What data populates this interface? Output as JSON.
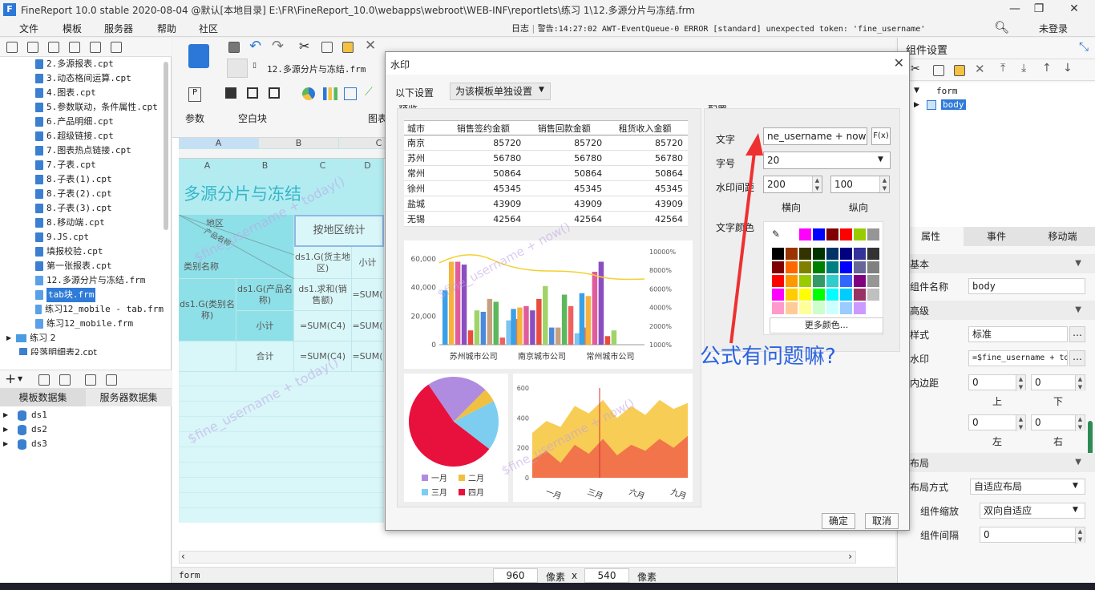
{
  "window": {
    "title": "FineReport 10.0 stable 2020-08-04 @默认[本地目录]    E:\\FR\\FineReport_10.0\\webapps\\webroot\\WEB-INF\\reportlets\\练习 1\\12.多源分片与冻结.frm",
    "minimize": "—",
    "maximize": "❐",
    "close": "✕"
  },
  "menubar": {
    "items": [
      "文件",
      "模板",
      "服务器",
      "帮助",
      "社区"
    ],
    "log_label": "日志",
    "warning_text": "警告:14:27:02 AWT-EventQueue-0 ERROR [standard] unexpected token: 'fine_username'",
    "login": "未登录"
  },
  "file_tree": {
    "items": [
      {
        "label": "2.多源报表.cpt",
        "type": "cpt"
      },
      {
        "label": "3.动态格间运算.cpt",
        "type": "cpt"
      },
      {
        "label": "4.图表.cpt",
        "type": "cpt"
      },
      {
        "label": "5.参数联动，条件属性.cpt",
        "type": "cpt"
      },
      {
        "label": "6.产品明细.cpt",
        "type": "cpt"
      },
      {
        "label": "6.超级链接.cpt",
        "type": "cpt"
      },
      {
        "label": "7.图表热点链接.cpt",
        "type": "cpt"
      },
      {
        "label": "7.子表.cpt",
        "type": "cpt"
      },
      {
        "label": "8.子表(1).cpt",
        "type": "cpt"
      },
      {
        "label": "8.子表(2).cpt",
        "type": "cpt"
      },
      {
        "label": "8.子表(3).cpt",
        "type": "cpt"
      },
      {
        "label": "8.移动端.cpt",
        "type": "cpt"
      },
      {
        "label": "9.JS.cpt",
        "type": "cpt"
      },
      {
        "label": "填报校验.cpt",
        "type": "cpt"
      },
      {
        "label": "第一张报表.cpt",
        "type": "cpt"
      },
      {
        "label": "12.多源分片与冻结.frm",
        "type": "frm"
      },
      {
        "label": "tab块.frm",
        "type": "frm",
        "selected": true
      },
      {
        "label": "练习12_mobile - tab.frm",
        "type": "frm"
      },
      {
        "label": "练习12_mobile.frm",
        "type": "frm"
      }
    ],
    "folder": "练习 2",
    "last_item": "段落明细表2.cpt"
  },
  "datasets": {
    "tabs": [
      "模板数据集",
      "服务器数据集"
    ],
    "items": [
      "ds1",
      "ds2",
      "ds3"
    ]
  },
  "ribbon": {
    "tab_name": "12.多源分片与冻结.frm",
    "group_param": "参数",
    "group_blank": "空白块",
    "group_chart": "图表"
  },
  "sheet": {
    "col_headers_top": [
      "A",
      "B",
      "C"
    ],
    "col_headers": [
      "A",
      "B",
      "C",
      "D"
    ],
    "report_title": "多源分片与冻结",
    "region_label": "地区",
    "product_label": "产品名称",
    "category_label": "类别名称",
    "region_stat": "按地区统计",
    "c3": "ds1.G(货主地区)",
    "d3": "小计",
    "a4": "ds1.G(类别名称)",
    "b4": "ds1.G(产品名称)",
    "c4": "ds1.求和(销售额)",
    "d4": "=SUM(",
    "b5": "小计",
    "c5": "=SUM(C4)",
    "d5": "=SUM(",
    "b6": "合计",
    "c6": "=SUM(C4)",
    "d6": "=SUM(",
    "watermark": "$fine_username + today()"
  },
  "statusbar": {
    "left": "form",
    "width": "960",
    "unit1": "像素",
    "x": "x",
    "height": "540",
    "unit2": "像素"
  },
  "right_panel": {
    "title": "组件设置",
    "tree_root": "form",
    "tree_child": "body",
    "tabs": [
      "属性",
      "事件",
      "移动端"
    ],
    "section_basic": "基本",
    "component_name_label": "组件名称",
    "component_name_value": "body",
    "section_advanced": "高级",
    "style_label": "样式",
    "style_value": "标准",
    "watermark_label": "水印",
    "watermark_value": "=$fine_username + today()",
    "padding_label": "内边距",
    "pad_top": "0",
    "pad_bottom": "0",
    "pad_left": "0",
    "pad_right": "0",
    "up": "上",
    "down": "下",
    "left": "左",
    "right": "右",
    "section_layout": "布局",
    "layout_mode_label": "布局方式",
    "layout_mode_value": "自适应布局",
    "scale_label": "组件缩放",
    "scale_value": "双向自适应",
    "gap_label": "组件间隔",
    "gap_value": "0"
  },
  "dialog": {
    "title": "水印",
    "setting_label": "以下设置",
    "setting_value": "为该模板单独设置",
    "preview_label": "预览",
    "config_label": "配置",
    "text_label": "文字",
    "text_value": "ne_username + now()",
    "fx": "F(x)",
    "size_label": "字号",
    "size_value": "20",
    "gap_label": "水印间距",
    "gap_h": "200",
    "gap_v": "100",
    "horizontal": "横向",
    "vertical": "纵向",
    "color_label": "文字颜色",
    "more_colors": "更多颜色...",
    "ok": "确定",
    "cancel": "取消",
    "table": {
      "headers": [
        "城市",
        "销售签约金额",
        "销售回款金额",
        "租货收入金额"
      ],
      "rows": [
        [
          "南京",
          "85720",
          "85720",
          "85720"
        ],
        [
          "苏州",
          "56780",
          "56780",
          "56780"
        ],
        [
          "常州",
          "50864",
          "50864",
          "50864"
        ],
        [
          "徐州",
          "45345",
          "45345",
          "45345"
        ],
        [
          "盐城",
          "43909",
          "43909",
          "43909"
        ],
        [
          "无锡",
          "42564",
          "42564",
          "42564"
        ]
      ]
    },
    "preview_watermark": "$fine_username + now()"
  },
  "chart_data": [
    {
      "type": "bar",
      "categories": [
        "苏州城市公司",
        "南京城市公司",
        "常州城市公司"
      ],
      "left_axis_ticks": [
        "0",
        "20,000",
        "40,000",
        "60,000"
      ],
      "right_axis_ticks": [
        "1000%",
        "2000%",
        "4000%",
        "6000%",
        "8000%",
        "10000%"
      ],
      "ylim": [
        0,
        65000
      ],
      "bars": [
        [
          38000,
          58000,
          58000,
          56000,
          10000,
          24000,
          23000,
          32000,
          30000,
          5000,
          17000,
          18000
        ],
        [
          25000,
          26000,
          27000,
          24000,
          32000,
          41000,
          12000,
          12000,
          35000,
          27000,
          8000,
          12000
        ],
        [
          36000,
          34000,
          51000,
          58000,
          6000,
          10000
        ]
      ],
      "bar_colors": [
        "#3aa0e8",
        "#f6b23c",
        "#e05c9c",
        "#8b4ec0",
        "#e74c3c",
        "#a0d468",
        "#4a89dc",
        "#c6a080",
        "#5cb85c",
        "#f06060",
        "#7dc4f0",
        "#d08060"
      ]
    },
    {
      "type": "pie",
      "legend": [
        "一月",
        "二月",
        "三月",
        "四月"
      ],
      "values": [
        22,
        5,
        18,
        55
      ],
      "colors": [
        "#b08ce0",
        "#f0c040",
        "#7ccdf0",
        "#e8103c"
      ]
    },
    {
      "type": "area",
      "categories": [
        "一月",
        "三月",
        "六月",
        "九月"
      ],
      "y_ticks": [
        "0",
        "200",
        "400",
        "600"
      ],
      "ylim": [
        0,
        600
      ],
      "series": [
        {
          "values": [
            300,
            380,
            340,
            480,
            430,
            520,
            400,
            480,
            420,
            520,
            460,
            500
          ]
        },
        {
          "values": [
            120,
            180,
            100,
            220,
            160,
            260,
            150,
            220,
            180,
            260,
            200,
            280
          ]
        }
      ]
    }
  ],
  "annotation": {
    "text": "公式有问题嘛?"
  }
}
